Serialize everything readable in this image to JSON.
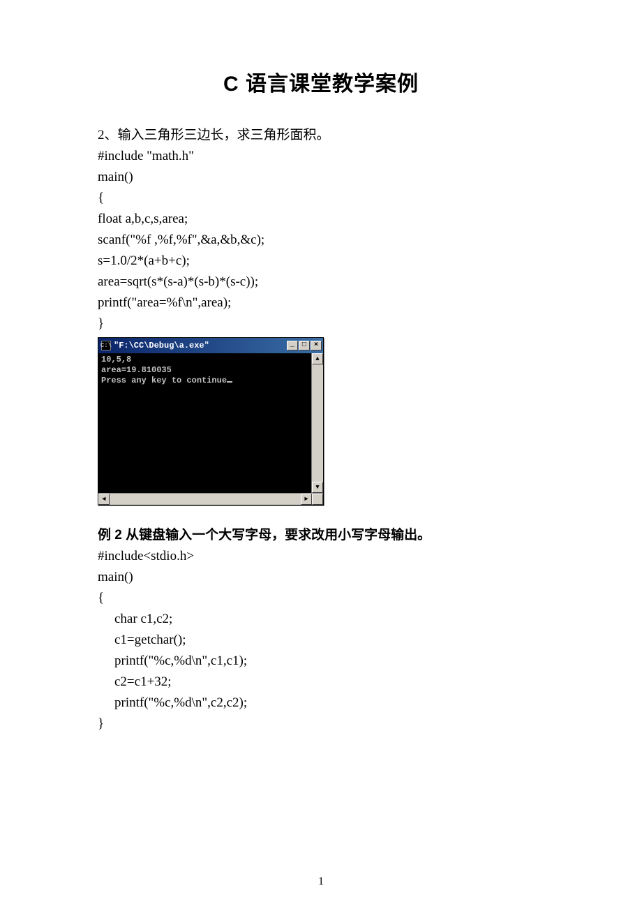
{
  "title": "C 语言课堂教学案例",
  "ex1": {
    "desc": "2、输入三角形三边长，求三角形面积。",
    "code": [
      "#include \"math.h\"",
      "main()",
      "{",
      "float a,b,c,s,area;",
      "scanf(\"%f ,%f,%f\",&a,&b,&c);",
      "s=1.0/2*(a+b+c);",
      "area=sqrt(s*(s-a)*(s-b)*(s-c));",
      "printf(\"area=%f\\n\",area);",
      "}"
    ]
  },
  "console": {
    "icon_text": "C:\\",
    "title": "\"F:\\CC\\Debug\\a.exe\"",
    "lines": [
      "10,5,8",
      "area=19.810035",
      "Press any key to continue"
    ],
    "btn_min": "_",
    "btn_max": "□",
    "btn_close": "×",
    "arrow_up": "▲",
    "arrow_down": "▼",
    "arrow_left": "◄",
    "arrow_right": "►"
  },
  "ex2": {
    "heading": "例 2 从键盘输入一个大写字母，要求改用小写字母输出。",
    "code_flat": [
      "#include<stdio.h>",
      "main()",
      "{"
    ],
    "code_indent": [
      "char c1,c2;",
      "c1=getchar();",
      "printf(\"%c,%d\\n\",c1,c1);",
      "c2=c1+32;",
      "printf(\"%c,%d\\n\",c2,c2);"
    ],
    "end": "}"
  },
  "page_number": "1"
}
